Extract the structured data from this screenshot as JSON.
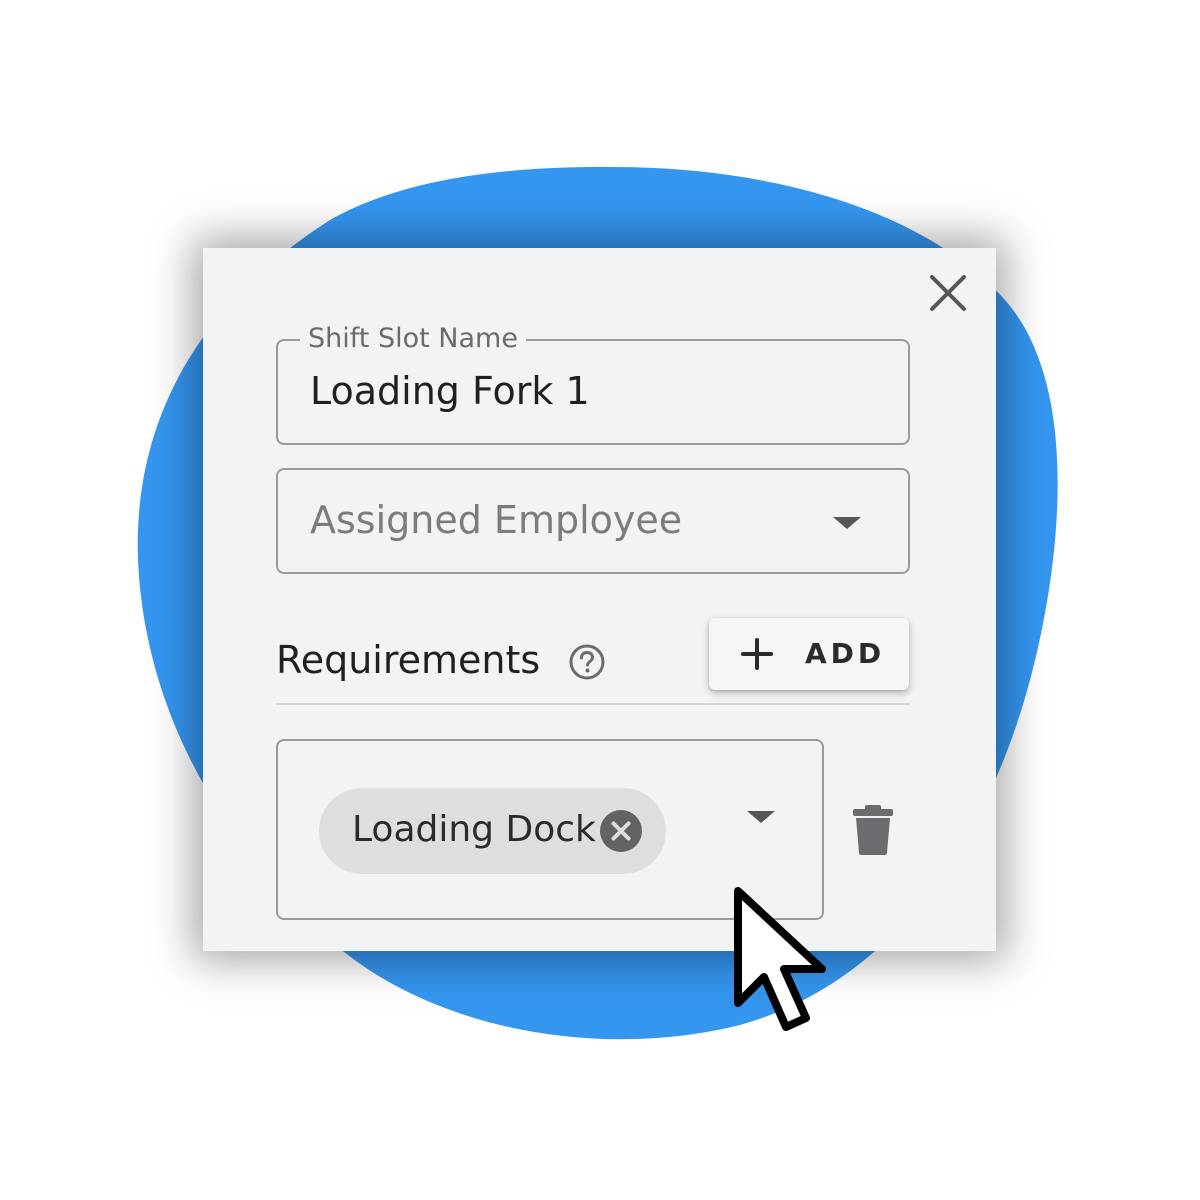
{
  "colors": {
    "blob": "#3596f0",
    "panel": "#f2f3f5",
    "text": "#1f2023",
    "muted": "#7b7c80",
    "border": "#9a9b9e",
    "chip": "#dddee0",
    "icon": "#6b6c70"
  },
  "dialog": {
    "close_icon": "close-icon"
  },
  "shift_slot_name": {
    "label": "Shift Slot Name",
    "value": "Loading Fork 1"
  },
  "assigned_employee": {
    "placeholder": "Assigned Employee",
    "icon": "chevron-down-icon"
  },
  "requirements": {
    "title": "Requirements",
    "help_icon": "help-circle-icon",
    "add_button": {
      "icon": "plus-icon",
      "label": "ADD"
    },
    "items": [
      {
        "chip_label": "Loading Dock",
        "remove_icon": "close-circle-icon",
        "dropdown_icon": "chevron-down-icon",
        "delete_icon": "trash-icon"
      }
    ]
  },
  "pointer": "mouse-pointer-icon"
}
